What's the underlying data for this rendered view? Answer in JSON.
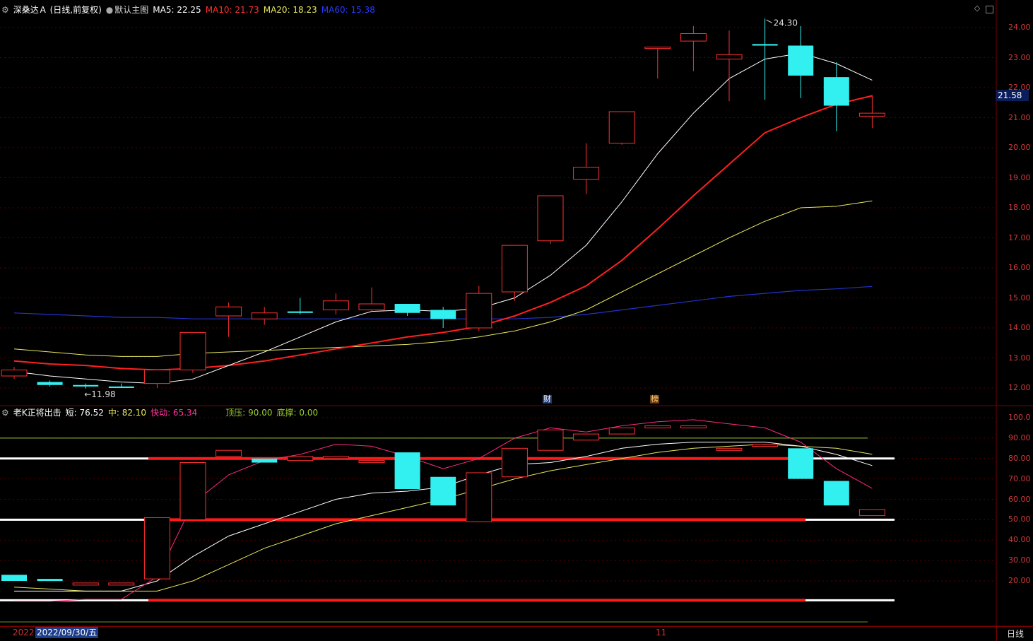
{
  "header_main": {
    "stock": "深桑达Ａ (日线,前复权)",
    "view": "默认主图",
    "ma5": "MA5: 22.25",
    "ma10": "MA10: 21.73",
    "ma20": "MA20: 18.23",
    "ma60": "MA60: 15.38"
  },
  "header_sub": {
    "name": "老K正将出击",
    "short": "短: 76.52",
    "mid": "中: 82.10",
    "fast": "快动: 65.34",
    "top": "顶压: 90.00",
    "bottom": "底撑: 0.00"
  },
  "price_axis": [
    "24.00",
    "23.00",
    "22.00",
    "21.00",
    "20.00",
    "19.00",
    "18.00",
    "17.00",
    "16.00",
    "15.00",
    "14.00",
    "13.00",
    "12.00"
  ],
  "sub_axis": [
    "100.0",
    "90.00",
    "80.00",
    "70.00",
    "60.00",
    "50.00",
    "40.00",
    "30.00",
    "20.00"
  ],
  "current_price": "21.58",
  "high_label": "24.30",
  "low_label": "11.98",
  "markers": {
    "fin": "财",
    "rank": "榜"
  },
  "date_left": "2022",
  "date_box": "2022/09/30/五",
  "month_label": "11",
  "period": "日线",
  "colors": {
    "up": "#ff3030",
    "down": "#33f0f0",
    "ma5": "#ffffff",
    "ma10": "#ff2020",
    "ma20": "#e8e860",
    "ma60": "#2233cc"
  },
  "chart_data": {
    "type": "candlestick",
    "candles": [
      {
        "o": 12.4,
        "c": 12.6,
        "h": 12.7,
        "l": 12.3
      },
      {
        "o": 12.2,
        "c": 12.1,
        "h": 12.25,
        "l": 12.05
      },
      {
        "o": 12.1,
        "c": 12.05,
        "h": 12.15,
        "l": 11.98
      },
      {
        "o": 12.05,
        "c": 12.0,
        "h": 12.15,
        "l": 12.0
      },
      {
        "o": 12.15,
        "c": 12.6,
        "h": 12.6,
        "l": 12.0
      },
      {
        "o": 12.6,
        "c": 13.85,
        "h": 13.85,
        "l": 12.5
      },
      {
        "o": 14.4,
        "c": 14.7,
        "h": 14.85,
        "l": 13.7
      },
      {
        "o": 14.3,
        "c": 14.5,
        "h": 14.7,
        "l": 14.1
      },
      {
        "o": 14.55,
        "c": 14.5,
        "h": 15.0,
        "l": 14.45
      },
      {
        "o": 14.6,
        "c": 14.9,
        "h": 15.15,
        "l": 14.45
      },
      {
        "o": 14.6,
        "c": 14.8,
        "h": 15.35,
        "l": 14.55
      },
      {
        "o": 14.8,
        "c": 14.5,
        "h": 14.8,
        "l": 14.4
      },
      {
        "o": 14.6,
        "c": 14.3,
        "h": 14.7,
        "l": 14.0
      },
      {
        "o": 14.0,
        "c": 15.15,
        "h": 15.4,
        "l": 13.9
      },
      {
        "o": 15.2,
        "c": 16.75,
        "h": 16.75,
        "l": 14.9
      },
      {
        "o": 16.9,
        "c": 18.4,
        "h": 18.4,
        "l": 16.8
      },
      {
        "o": 18.95,
        "c": 19.35,
        "h": 20.15,
        "l": 18.45
      },
      {
        "o": 20.15,
        "c": 21.2,
        "h": 21.2,
        "l": 20.1
      },
      {
        "o": 23.35,
        "c": 23.35,
        "h": 23.35,
        "l": 22.3
      },
      {
        "o": 23.55,
        "c": 23.8,
        "h": 24.05,
        "l": 22.55
      },
      {
        "o": 22.95,
        "c": 23.1,
        "h": 23.9,
        "l": 21.55
      },
      {
        "o": 23.45,
        "c": 23.4,
        "h": 24.3,
        "l": 21.6
      },
      {
        "o": 23.4,
        "c": 22.4,
        "h": 24.05,
        "l": 21.65
      },
      {
        "o": 22.35,
        "c": 21.4,
        "h": 22.85,
        "l": 20.55
      },
      {
        "o": 21.05,
        "c": 21.15,
        "h": 21.75,
        "l": 20.65
      }
    ],
    "ma5": [
      12.55,
      12.4,
      12.3,
      12.2,
      12.15,
      12.3,
      12.75,
      13.2,
      13.7,
      14.2,
      14.55,
      14.6,
      14.55,
      14.65,
      15.0,
      15.75,
      16.75,
      18.2,
      19.8,
      21.15,
      22.3,
      22.95,
      23.15,
      22.8,
      22.25
    ],
    "ma10": [
      12.9,
      12.8,
      12.75,
      12.65,
      12.6,
      12.65,
      12.75,
      12.9,
      13.1,
      13.3,
      13.5,
      13.7,
      13.85,
      14.05,
      14.4,
      14.85,
      15.4,
      16.25,
      17.3,
      18.4,
      19.45,
      20.5,
      21.0,
      21.45,
      21.73
    ],
    "ma20": [
      13.3,
      13.2,
      13.1,
      13.05,
      13.05,
      13.15,
      13.2,
      13.25,
      13.3,
      13.35,
      13.4,
      13.45,
      13.55,
      13.7,
      13.9,
      14.2,
      14.6,
      15.2,
      15.8,
      16.4,
      17.0,
      17.55,
      18.0,
      18.05,
      18.23
    ],
    "ma60": [
      14.5,
      14.45,
      14.4,
      14.35,
      14.35,
      14.3,
      14.3,
      14.3,
      14.3,
      14.3,
      14.3,
      14.3,
      14.3,
      14.3,
      14.3,
      14.35,
      14.45,
      14.6,
      14.75,
      14.9,
      15.05,
      15.15,
      15.25,
      15.3,
      15.38
    ],
    "indicator": {
      "bars": [
        {
          "o": 23,
          "c": 20
        },
        {
          "o": 21,
          "c": 20
        },
        {
          "o": 19,
          "c": 19
        },
        {
          "o": 19,
          "c": 19
        },
        {
          "o": 21,
          "c": 51
        },
        {
          "o": 50,
          "c": 78
        },
        {
          "o": 81,
          "c": 84
        },
        {
          "o": 80,
          "c": 78
        },
        {
          "o": 79,
          "c": 81
        },
        {
          "o": 81,
          "c": 81
        },
        {
          "o": 79,
          "c": 79
        },
        {
          "o": 83,
          "c": 65
        },
        {
          "o": 71,
          "c": 57
        },
        {
          "o": 49,
          "c": 73
        },
        {
          "o": 71,
          "c": 85
        },
        {
          "o": 84,
          "c": 94
        },
        {
          "o": 89,
          "c": 92
        },
        {
          "o": 92,
          "c": 95
        },
        {
          "o": 95,
          "c": 96
        },
        {
          "o": 95,
          "c": 96
        },
        {
          "o": 85,
          "c": 85
        },
        {
          "o": 86,
          "c": 87
        },
        {
          "o": 85,
          "c": 70
        },
        {
          "o": 69,
          "c": 57
        },
        {
          "o": 52,
          "c": 55
        }
      ],
      "short": [
        15,
        15,
        15,
        15,
        20,
        32,
        42,
        48,
        54,
        60,
        63,
        64,
        66,
        72,
        77,
        78,
        81,
        85,
        87,
        88,
        88,
        88,
        86,
        82,
        76.52
      ],
      "mid": [
        17,
        16,
        15,
        15,
        15,
        20,
        28,
        36,
        42,
        48,
        52,
        56,
        60,
        65,
        70,
        74,
        77,
        80,
        83,
        85,
        86,
        87,
        86,
        85,
        82.1
      ],
      "fast": [
        10,
        10,
        11,
        11,
        22,
        58,
        72,
        79,
        82,
        87,
        86,
        81,
        75,
        80,
        90,
        95,
        93,
        96,
        98,
        99,
        97,
        95,
        88,
        75,
        65.34
      ],
      "top_line": 90,
      "bottom_line": 0
    }
  }
}
